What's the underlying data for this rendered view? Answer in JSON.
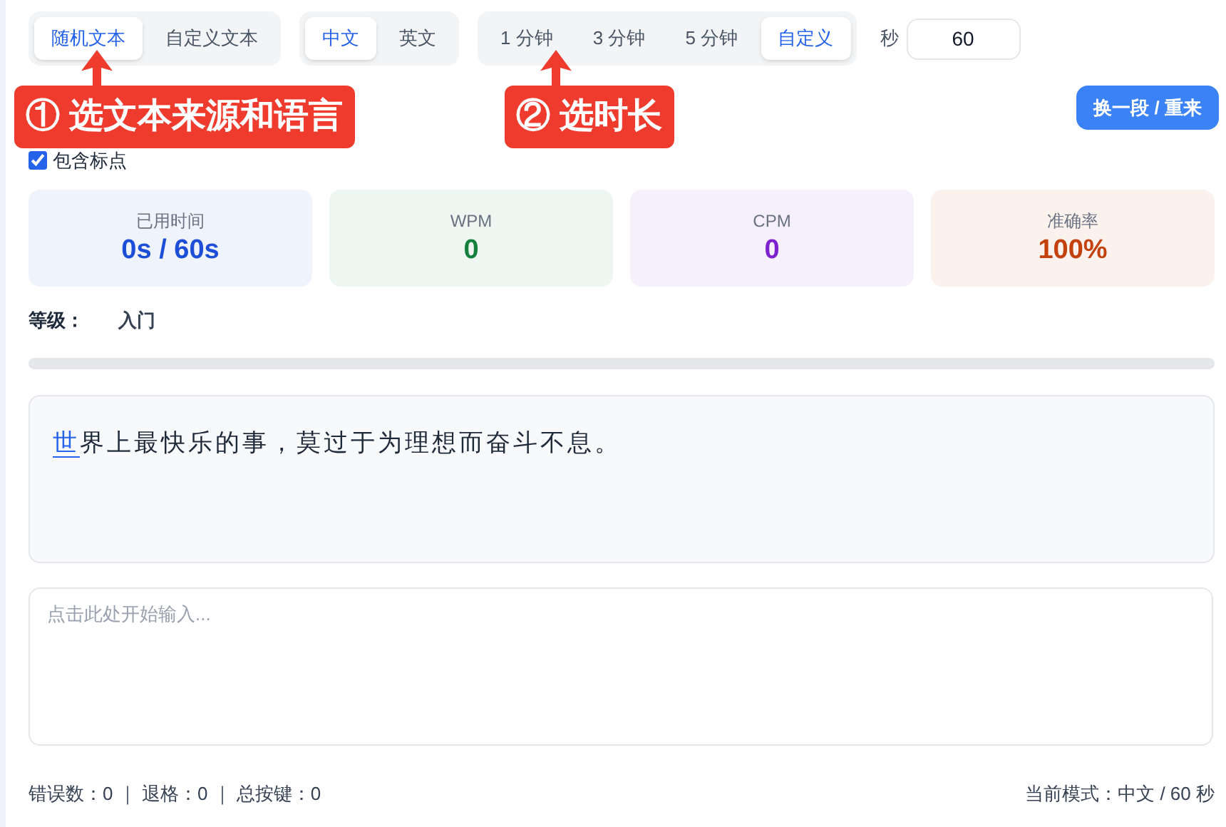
{
  "source_tabs": [
    {
      "label": "随机文本",
      "selected": true
    },
    {
      "label": "自定义文本",
      "selected": false
    }
  ],
  "language_tabs": [
    {
      "label": "中文",
      "selected": true
    },
    {
      "label": "英文",
      "selected": false
    }
  ],
  "duration_tabs": [
    {
      "label": "1 分钟",
      "selected": false
    },
    {
      "label": "3 分钟",
      "selected": false
    },
    {
      "label": "5 分钟",
      "selected": false
    },
    {
      "label": "自定义",
      "selected": true
    }
  ],
  "seconds_label": "秒",
  "seconds_field": {
    "value": "60"
  },
  "restart_button": "换一段 / 重来",
  "include_punctuation": {
    "label": "包含标点",
    "checked": true
  },
  "stats": [
    {
      "label": "已用时间",
      "value": "0s / 60s",
      "color": "#1d4ed8"
    },
    {
      "label": "WPM",
      "value": "0",
      "color": "#15803d"
    },
    {
      "label": "CPM",
      "value": "0",
      "color": "#7e22ce"
    },
    {
      "label": "准确率",
      "value": "100%",
      "color": "#c2410c"
    }
  ],
  "level": {
    "label": "等级：",
    "value": "入门"
  },
  "progress": {
    "level": 0
  },
  "passage": [
    {
      "text": "世",
      "current": true
    },
    {
      "text": "界上最快乐的事，莫过于为理想而奋斗不息。",
      "current": false
    }
  ],
  "input": {
    "placeholder": "点击此处开始输入..."
  },
  "footer": {
    "counts": "错误数：0 ｜ 退格：0 ｜ 总按键：0",
    "mode": "当前模式：中文 / 60 秒"
  },
  "annotations": [
    {
      "text": "① 选文本来源和语言"
    },
    {
      "text": "② 选时长"
    }
  ]
}
